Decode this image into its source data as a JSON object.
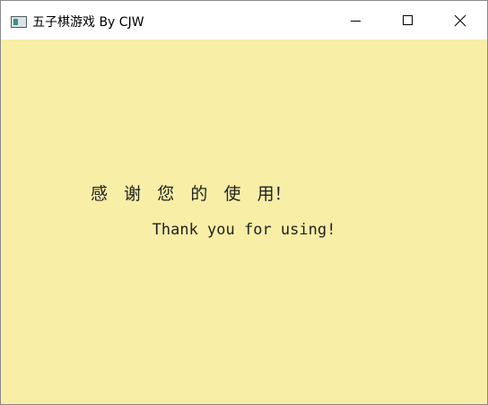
{
  "window": {
    "title": "五子棋游戏 By CJW",
    "app_icon": "app-window-icon",
    "controls": {
      "minimize_icon": "minimize-icon",
      "maximize_icon": "maximize-icon",
      "close_icon": "close-icon"
    }
  },
  "content": {
    "background_color": "#f8eea6",
    "thanks_chinese": "感   谢   您   的   使   用！",
    "thanks_english": "Thank you for using!"
  }
}
